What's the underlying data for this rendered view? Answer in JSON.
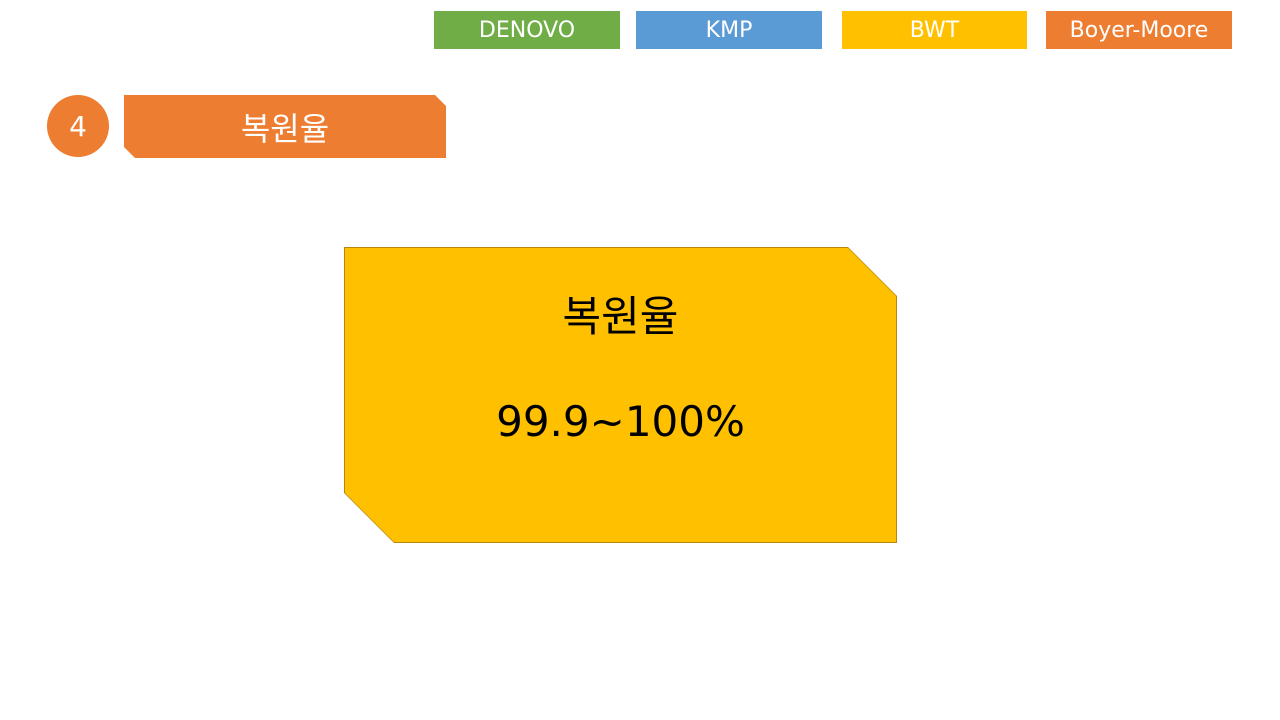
{
  "header_tags": [
    {
      "label": "DENOVO",
      "color": "#70ad47"
    },
    {
      "label": "KMP",
      "color": "#5b9bd5"
    },
    {
      "label": "BWT",
      "color": "#ffc000"
    },
    {
      "label": "Boyer-Moore",
      "color": "#ed7d31"
    }
  ],
  "section": {
    "number": "4",
    "title": "복원율",
    "color": "#ed7d31"
  },
  "card": {
    "title": "복원율",
    "value": "99.9~100%",
    "color": "#ffc000"
  }
}
